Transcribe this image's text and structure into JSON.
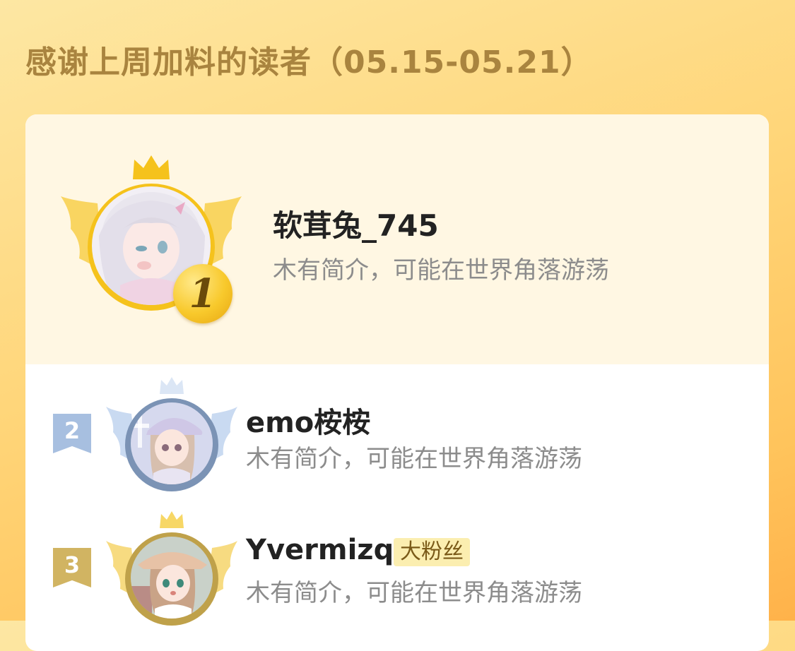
{
  "header": {
    "title": "感谢上周加料的读者（05.15-05.21）"
  },
  "colors": {
    "gold": "#f5c21c",
    "silver_ring": "#7b93b5",
    "bronze_ring": "#bfa14a",
    "silver_ribbon": "#a7bfe0",
    "bronze_ribbon": "#d1b462"
  },
  "readers": [
    {
      "rank": "1",
      "name": "软茸兔_745",
      "bio": "木有简介，可能在世界角落游荡",
      "badge": ""
    },
    {
      "rank": "2",
      "name": "emo桉桉",
      "bio": "木有简介，可能在世界角落游荡",
      "badge": ""
    },
    {
      "rank": "3",
      "name": "Yvermizq",
      "bio": "木有简介，可能在世界角落游荡",
      "badge": "大粉丝"
    }
  ]
}
